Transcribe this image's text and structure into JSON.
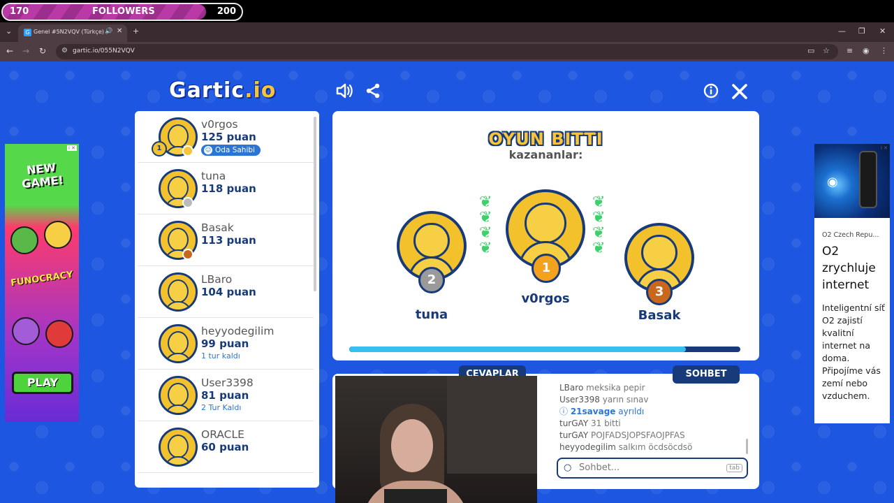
{
  "followers": {
    "min": "170",
    "label": "FOLLOWERS",
    "max": "200",
    "progress": 0.85
  },
  "browser": {
    "tab_title": "Genel #5N2VQV (Türkçe) -",
    "url": "gartic.io/055N2VQV",
    "favicon": "G"
  },
  "logo": {
    "main": "Gartic",
    "suffix": ".io"
  },
  "players": [
    {
      "name": "v0rgos",
      "points": "125 puan",
      "badge": "Oda Sahibi",
      "sub": "",
      "dot": "#f7c43a",
      "rank": "1"
    },
    {
      "name": "tuna",
      "points": "118 puan",
      "badge": "",
      "sub": "",
      "dot": "#bbbbbb",
      "rank": ""
    },
    {
      "name": "Basak",
      "points": "113 puan",
      "badge": "",
      "sub": "",
      "dot": "#c9681c",
      "rank": ""
    },
    {
      "name": "LBaro",
      "points": "104 puan",
      "badge": "",
      "sub": "",
      "dot": "",
      "rank": ""
    },
    {
      "name": "heyyodegilim",
      "points": "99 puan",
      "badge": "",
      "sub": "1 tur kaldı",
      "dot": "",
      "rank": ""
    },
    {
      "name": "User3398",
      "points": "81 puan",
      "badge": "",
      "sub": "2 Tur Kaldı",
      "dot": "",
      "rank": ""
    },
    {
      "name": "ORACLE",
      "points": "60 puan",
      "badge": "",
      "sub": "",
      "dot": "",
      "rank": ""
    }
  ],
  "result": {
    "title": "OYUN BITTI",
    "subtitle": "kazananlar:",
    "first": {
      "name": "v0rgos",
      "medal": "1",
      "color": "#f3a21e"
    },
    "second": {
      "name": "tuna",
      "medal": "2",
      "color": "#9a9a9a"
    },
    "third": {
      "name": "Basak",
      "medal": "3",
      "color": "#c9681c"
    },
    "progress": 0.86
  },
  "chat": {
    "answers_tab": "CEVAPLAR",
    "chat_tab": "SOHBET",
    "messages": [
      {
        "user": "LBaro",
        "text": "meksika pepir",
        "system": false
      },
      {
        "user": "User3398",
        "text": "yarın sınav",
        "system": false
      },
      {
        "user": "21savage",
        "text": "ayrıldı",
        "system": true
      },
      {
        "user": "turGAY",
        "text": "31 bitti",
        "system": false
      },
      {
        "user": "turGAY",
        "text": "POJFADSJOPSFAOJPFAS",
        "system": false
      },
      {
        "user": "heyyodegilim",
        "text": "salkım öcdsöcdsö",
        "system": false
      }
    ],
    "placeholder": "Sohbet...",
    "key_hint": "tab"
  },
  "ad_left": {
    "headline": "NEW GAME!",
    "brand": "FUNOCRACY",
    "cta": "PLAY"
  },
  "ad_right": {
    "source": "O2 Czech Repu...",
    "headline": "O2 zrychluje internet",
    "body": "Inteligentní síť O2 zajistí kvalitní internet na doma. Připojíme vás zemí nebo vzduchem."
  }
}
